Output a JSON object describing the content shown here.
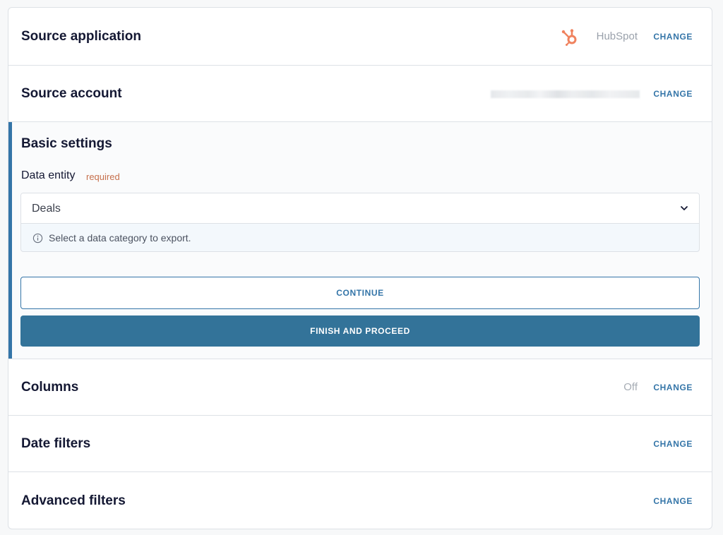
{
  "sections": {
    "source_application": {
      "title": "Source application",
      "value": "HubSpot",
      "icon": "hubspot-logo-icon",
      "change": "CHANGE"
    },
    "source_account": {
      "title": "Source account",
      "value_blurred": true,
      "change": "CHANGE"
    },
    "basic_settings": {
      "title": "Basic settings",
      "field_label": "Data entity",
      "field_required": "required",
      "select_value": "Deals",
      "hint": "Select a data category to export.",
      "continue_label": "CONTINUE",
      "finish_label": "FINISH AND PROCEED"
    },
    "columns": {
      "title": "Columns",
      "value": "Off",
      "change": "CHANGE"
    },
    "date_filters": {
      "title": "Date filters",
      "change": "CHANGE"
    },
    "advanced_filters": {
      "title": "Advanced filters",
      "change": "CHANGE"
    }
  },
  "colors": {
    "accent": "#3475a8",
    "primary_button": "#337399",
    "hubspot_orange": "#f0825e",
    "required_text": "#c6704d"
  }
}
